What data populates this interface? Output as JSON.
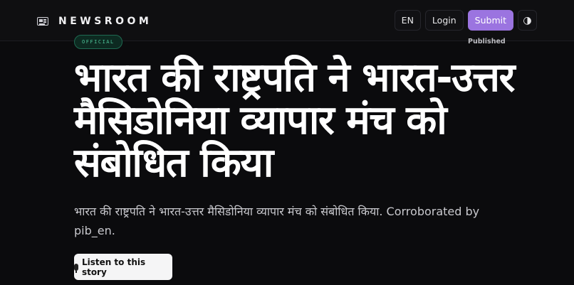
{
  "header": {
    "brand_icon": "newspaper-icon",
    "brand_name": "NEWSROOM",
    "lang_label": "EN",
    "login_label": "Login",
    "submit_label": "Submit",
    "theme_icon": "contrast-icon",
    "theme_glyph": "◑",
    "accent_color": "#9b74e0"
  },
  "article": {
    "badge": "OFFICIAL",
    "published_label": "Published",
    "headline": "भारत की राष्ट्रपति ने भारत-उत्तर मैसिडोनिया व्यापार मंच को संबोधित किया",
    "summary": "भारत की राष्ट्रपति ने भारत-उत्तर मैसिडोनिया व्यापार मंच को संबोधित किया. Corroborated by pib_en.",
    "listen_label": "Listen to this story",
    "listen_icon": "microphone-icon"
  }
}
